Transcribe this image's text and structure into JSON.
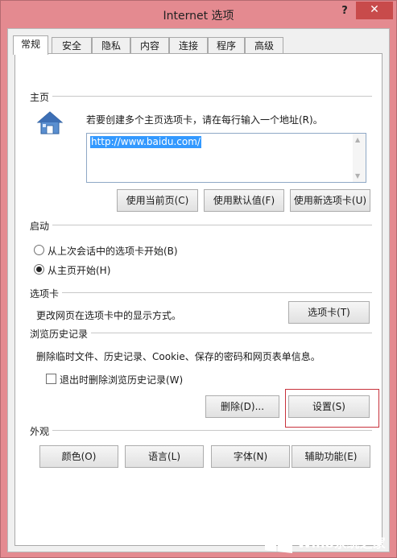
{
  "window": {
    "title": "Internet 选项",
    "help": "?",
    "close": "✕"
  },
  "tabs": [
    "常规",
    "安全",
    "隐私",
    "内容",
    "连接",
    "程序",
    "高级"
  ],
  "home": {
    "section_label": "主页",
    "instruction": "若要创建多个主页选项卡，请在每行输入一个地址(R)。",
    "url": "http://www.baidu.com/",
    "buttons": {
      "use_current": "使用当前页(C)",
      "use_default": "使用默认值(F)",
      "use_new_tab": "使用新选项卡(U)"
    }
  },
  "startup": {
    "section_label": "启动",
    "option_last_session": "从上次会话中的选项卡开始(B)",
    "option_home": "从主页开始(H)",
    "selected": "home"
  },
  "tabs_section": {
    "section_label": "选项卡",
    "description": "更改网页在选项卡中的显示方式。",
    "button": "选项卡(T)"
  },
  "history": {
    "section_label": "浏览历史记录",
    "description": "删除临时文件、历史记录、Cookie、保存的密码和网页表单信息。",
    "checkbox_label": "退出时删除浏览历史记录(W)",
    "checkbox_checked": false,
    "delete_button": "删除(D)...",
    "settings_button": "设置(S)"
  },
  "appearance": {
    "section_label": "外观",
    "buttons": {
      "colors": "颜色(O)",
      "languages": "语言(L)",
      "fonts": "字体(N)",
      "accessibility": "辅助功能(E)"
    }
  },
  "watermark": {
    "text": "Win8系统之家"
  },
  "colors": {
    "frame": "#e48a90",
    "close": "#c84b4b",
    "selection": "#3399ff",
    "highlight_box": "#c8323c"
  }
}
